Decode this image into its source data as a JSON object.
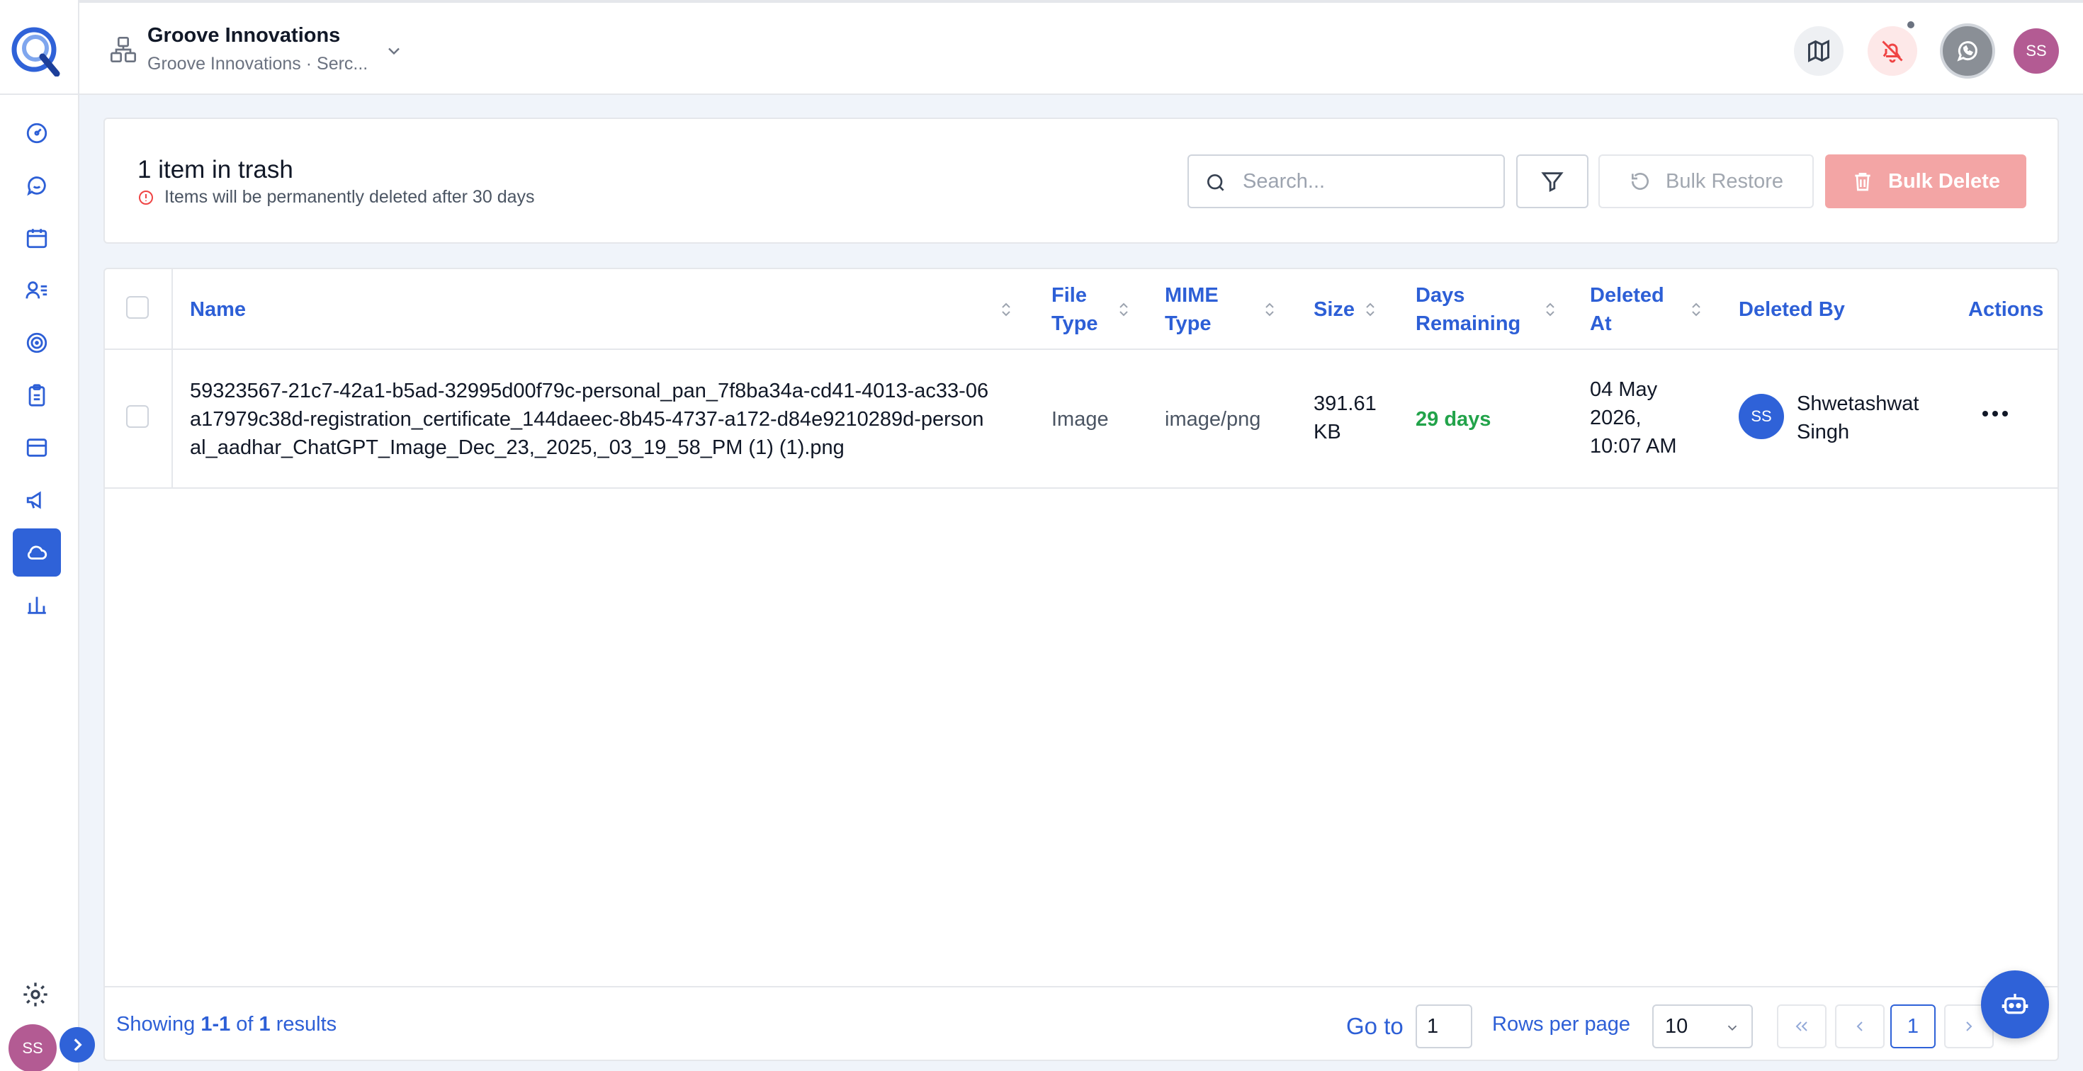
{
  "header": {
    "org_name": "Groove Innovations",
    "org_sub": "Groove Innovations · Serc...",
    "user_initials": "SS"
  },
  "sidebar": {
    "items": [
      {
        "icon": "dashboard-gauge-icon"
      },
      {
        "icon": "chat-bubble-icon"
      },
      {
        "icon": "calendar-icon"
      },
      {
        "icon": "contacts-list-icon"
      },
      {
        "icon": "target-icon"
      },
      {
        "icon": "clipboard-icon"
      },
      {
        "icon": "inbox-box-icon"
      },
      {
        "icon": "megaphone-icon"
      },
      {
        "icon": "cloud-icon",
        "active": true
      },
      {
        "icon": "bar-chart-icon"
      }
    ],
    "user_initials": "SS"
  },
  "trash": {
    "title": "1 item in trash",
    "note": "Items will be permanently deleted after 30 days",
    "search_placeholder": "Search...",
    "bulk_restore": "Bulk Restore",
    "bulk_delete": "Bulk Delete"
  },
  "table": {
    "columns": {
      "name": "Name",
      "file_type": "File Type",
      "mime_type": "MIME Type",
      "size": "Size",
      "days_remaining": "Days Remaining",
      "deleted_at": "Deleted At",
      "deleted_by": "Deleted By",
      "actions": "Actions"
    },
    "rows": [
      {
        "name": "59323567-21c7-42a1-b5ad-32995d00f79c-personal_pan_7f8ba34a-cd41-4013-ac33-06a17979c38d-registration_certificate_144daeec-8b45-4737-a172-d84e9210289d-personal_aadhar_ChatGPT_Image_Dec_23,_2025,_03_19_58_PM (1) (1).png",
        "file_type": "Image",
        "mime_type": "image/png",
        "size": "391.61 KB",
        "days_remaining": "29 days",
        "deleted_at": "04 May 2026, 10:07 AM",
        "deleted_by_initials": "SS",
        "deleted_by": "Shwetashwat Singh"
      }
    ]
  },
  "footer": {
    "showing_prefix": "Showing ",
    "showing_range": "1-1",
    "showing_of": " of ",
    "showing_total": "1",
    "showing_suffix": " results",
    "goto_label": "Go to",
    "goto_value": "1",
    "rows_per_page_label": "Rows per page",
    "rows_per_page_value": "10",
    "current_page": "1"
  },
  "colors": {
    "accent": "#2f62d8",
    "danger": "#ef4444",
    "success": "#22a34a"
  }
}
